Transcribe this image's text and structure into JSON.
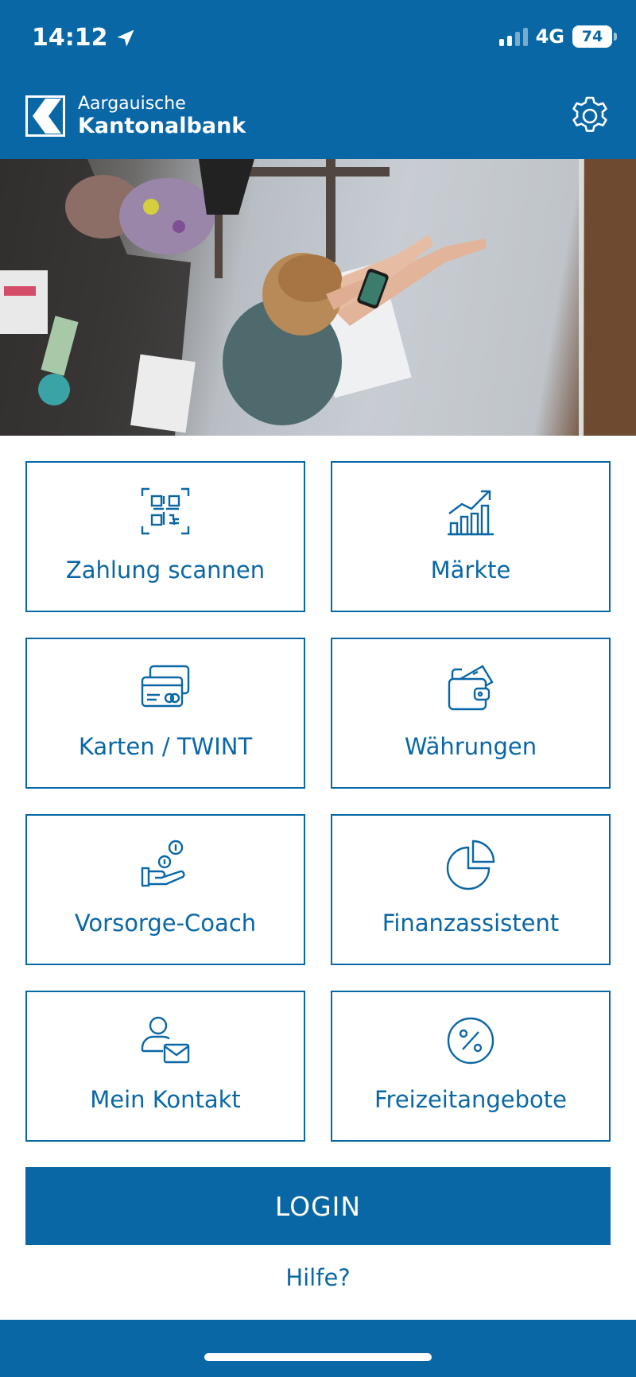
{
  "status_bar": {
    "time": "14:12",
    "network": "4G",
    "battery": "74"
  },
  "header": {
    "brand_line1": "Aargauische",
    "brand_line2": "Kantonalbank"
  },
  "hero": {
    "description": "hero-photo"
  },
  "tiles": [
    {
      "label": "Zahlung scannen",
      "icon": "qr-scan-icon"
    },
    {
      "label": "Märkte",
      "icon": "bar-chart-trend-icon"
    },
    {
      "label": "Karten / TWINT",
      "icon": "cards-icon"
    },
    {
      "label": "Währungen",
      "icon": "wallet-icon"
    },
    {
      "label": "Vorsorge-Coach",
      "icon": "hand-coins-icon"
    },
    {
      "label": "Finanzassistent",
      "icon": "pie-chart-icon"
    },
    {
      "label": "Mein Kontakt",
      "icon": "person-mail-icon"
    },
    {
      "label": "Freizeitangebote",
      "icon": "percent-circle-icon"
    }
  ],
  "login_label": "LOGIN",
  "help_label": "Hilfe?",
  "colors": {
    "brand_blue": "#0a67a6",
    "white": "#ffffff"
  }
}
